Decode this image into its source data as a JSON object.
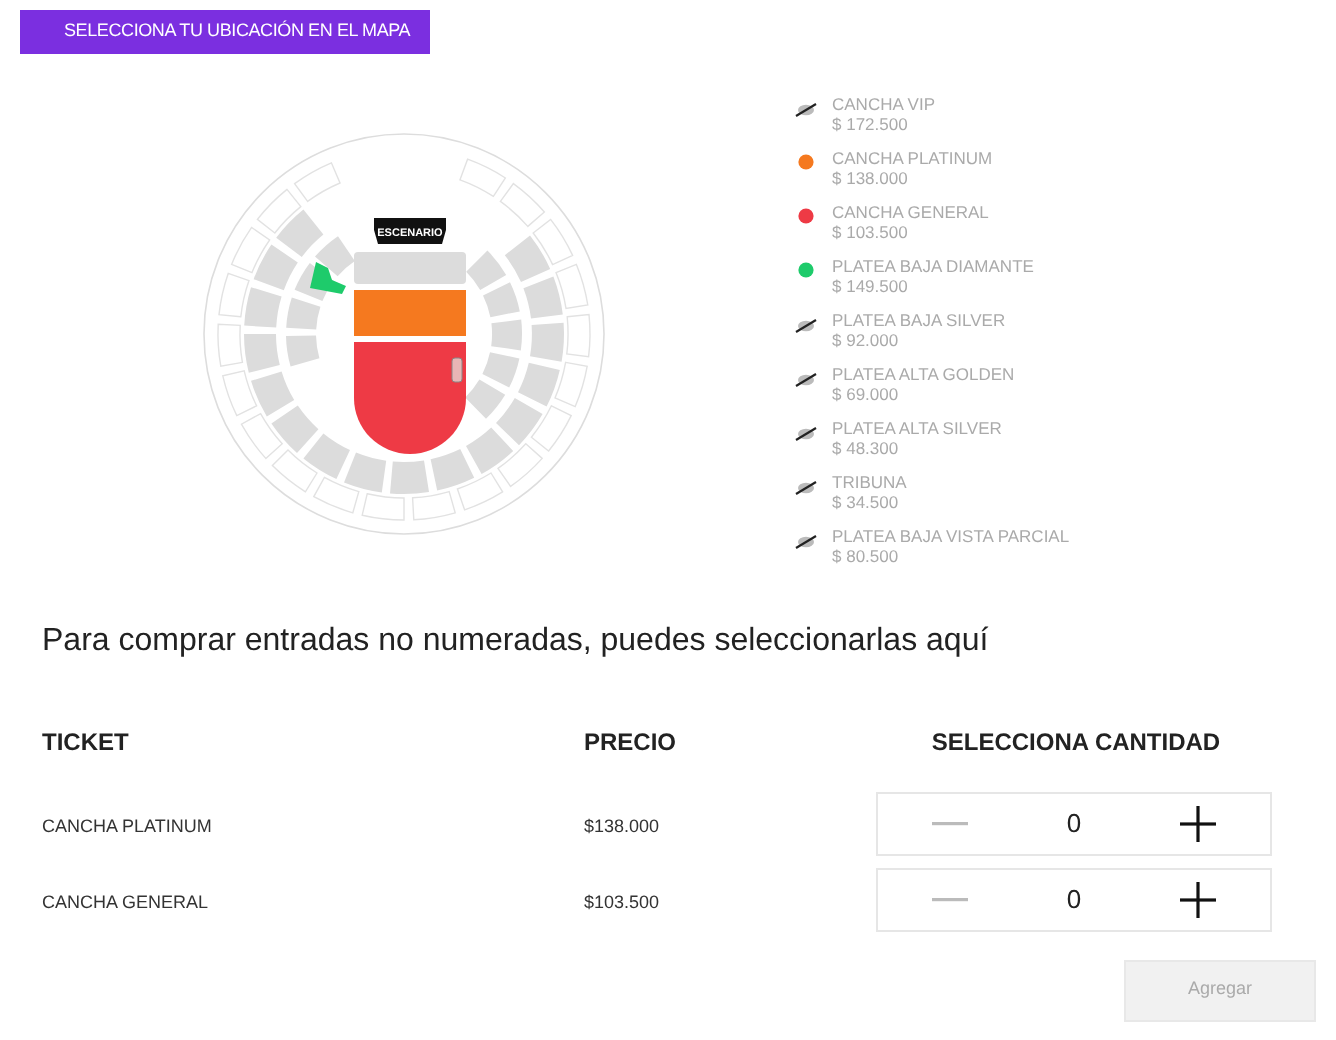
{
  "header": {
    "title": "SELECCIONA TU UBICACIÓN EN EL MAPA"
  },
  "map": {
    "stage_label": "ESCENARIO"
  },
  "legend": [
    {
      "name": "CANCHA VIP",
      "price": "$ 172.500",
      "kind": "soldout"
    },
    {
      "name": "CANCHA PLATINUM",
      "price": "$ 138.000",
      "kind": "available",
      "color": "#f5791f"
    },
    {
      "name": "CANCHA GENERAL",
      "price": "$ 103.500",
      "kind": "available",
      "color": "#ee3a45"
    },
    {
      "name": "PLATEA BAJA DIAMANTE",
      "price": "$ 149.500",
      "kind": "available",
      "color": "#1ecb6b"
    },
    {
      "name": "PLATEA BAJA SILVER",
      "price": "$ 92.000",
      "kind": "soldout"
    },
    {
      "name": "PLATEA ALTA GOLDEN",
      "price": "$ 69.000",
      "kind": "soldout"
    },
    {
      "name": "PLATEA ALTA SILVER",
      "price": "$ 48.300",
      "kind": "soldout"
    },
    {
      "name": "TRIBUNA",
      "price": "$ 34.500",
      "kind": "soldout"
    },
    {
      "name": "PLATEA BAJA VISTA PARCIAL",
      "price": "$ 80.500",
      "kind": "soldout"
    }
  ],
  "intro": "Para comprar entradas no numeradas, puedes seleccionarlas aquí",
  "table": {
    "columns": [
      "TICKET",
      "PRECIO",
      "SELECCIONA CANTIDAD"
    ],
    "rows": [
      {
        "ticket": "CANCHA PLATINUM",
        "price": "$138.000",
        "quantity": "0",
        "minus_disabled": true,
        "plus_disabled": false
      },
      {
        "ticket": "CANCHA GENERAL",
        "price": "$103.500",
        "quantity": "0",
        "minus_disabled": true,
        "plus_disabled": false
      }
    ]
  },
  "add_button": {
    "label": "Agregar",
    "disabled": true
  }
}
